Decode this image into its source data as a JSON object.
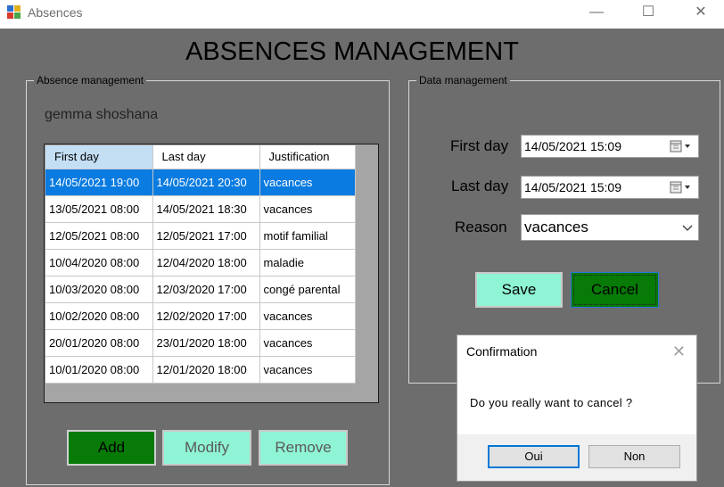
{
  "window": {
    "title": "Absences",
    "minimize": "—",
    "maximize": "☐",
    "close": "✕"
  },
  "page": {
    "title": "ABSENCES MANAGEMENT"
  },
  "absence_group": {
    "legend": "Absence management",
    "student_name": "gemma shoshana",
    "columns": [
      "First day",
      "Last day",
      "Justification"
    ],
    "rows": [
      [
        "14/05/2021 19:00",
        "14/05/2021 20:30",
        "vacances"
      ],
      [
        "13/05/2021 08:00",
        "14/05/2021 18:30",
        "vacances"
      ],
      [
        "12/05/2021 08:00",
        "12/05/2021 17:00",
        "motif familial"
      ],
      [
        "10/04/2020 08:00",
        "12/04/2020 18:00",
        "maladie"
      ],
      [
        "10/03/2020 08:00",
        "12/03/2020 17:00",
        "congé parental"
      ],
      [
        "10/02/2020 08:00",
        "12/02/2020 17:00",
        "vacances"
      ],
      [
        "20/01/2020 08:00",
        "23/01/2020 18:00",
        "vacances"
      ],
      [
        "10/01/2020 08:00",
        "12/01/2020 18:00",
        "vacances"
      ]
    ],
    "selected_row": 0,
    "buttons": {
      "add": "Add",
      "modify": "Modify",
      "remove": "Remove"
    }
  },
  "data_group": {
    "legend": "Data management",
    "first_day_label": "First day",
    "first_day_value": "14/05/2021 15:09",
    "last_day_label": "Last day",
    "last_day_value": "14/05/2021 15:09",
    "reason_label": "Reason",
    "reason_value": "vacances",
    "save": "Save",
    "cancel": "Cancel"
  },
  "dialog": {
    "title": "Confirmation",
    "close": "✕",
    "message": "Do you really want to cancel ?",
    "yes": "Oui",
    "no": "Non"
  },
  "colors": {
    "background": "#6d6d6d",
    "dark_green": "#077a07",
    "mint": "#8ff4d5",
    "selection": "#0a7be0"
  }
}
